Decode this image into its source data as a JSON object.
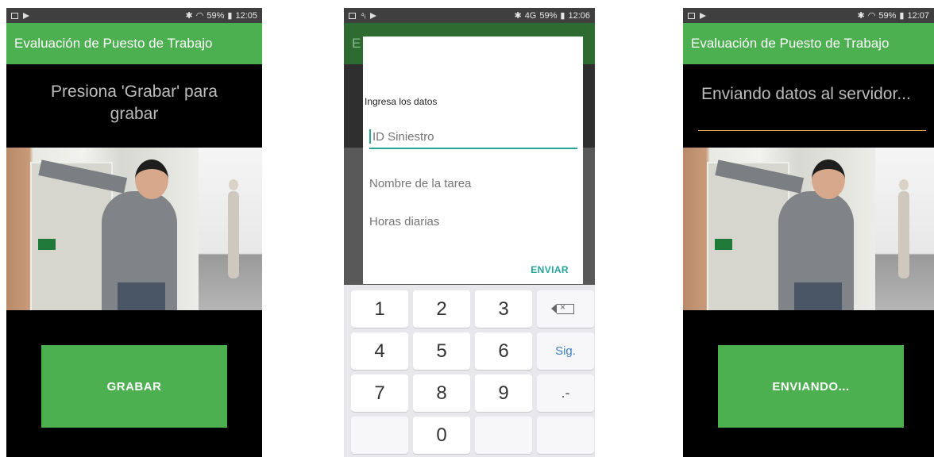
{
  "phone1": {
    "status": {
      "battery": "59%",
      "time": "12:05"
    },
    "app_title": "Evaluación de Puesto de Trabajo",
    "message": "Presiona 'Grabar' para grabar",
    "button_label": "GRABAR"
  },
  "phone2": {
    "status": {
      "signal": "4G",
      "battery": "59%",
      "time": "12:06"
    },
    "app_title_partial": "E",
    "dialog": {
      "title": "Ingresa los datos",
      "field1_placeholder": "ID Siniestro",
      "field2_placeholder": "Nombre de la tarea",
      "field3_placeholder": "Horas diarias",
      "button": "ENVIAR"
    },
    "keyboard": {
      "row1": [
        "1",
        "2",
        "3"
      ],
      "row2": [
        "4",
        "5",
        "6"
      ],
      "row3": [
        "7",
        "8",
        "9"
      ],
      "row4": [
        "0"
      ],
      "next_label": "Sig.",
      "symbol_label": ".-",
      "backspace_icon": "backspace-icon"
    }
  },
  "phone3": {
    "status": {
      "battery": "59%",
      "time": "12:07"
    },
    "app_title": "Evaluación de Puesto de Trabajo",
    "message": "Enviando datos al servidor...",
    "button_label": "ENVIANDO..."
  },
  "colors": {
    "app_green": "#4caf50",
    "accent_teal": "#26a69a",
    "progress_orange": "#e4a64a",
    "background_black": "#000000"
  }
}
